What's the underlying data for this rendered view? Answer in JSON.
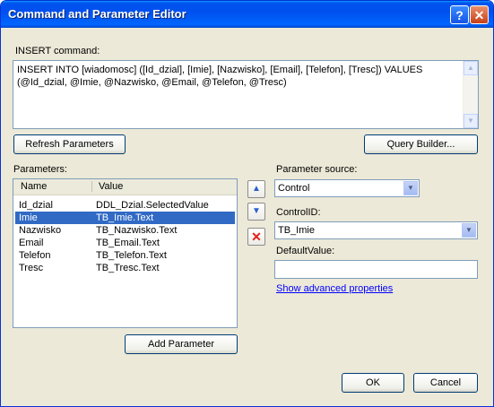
{
  "window": {
    "title": "Command and Parameter Editor",
    "help_glyph": "?",
    "close_glyph": "✕"
  },
  "command": {
    "label": "INSERT command:",
    "text": "INSERT INTO [wiadomosc] ([Id_dzial], [Imie], [Nazwisko], [Email], [Telefon], [Tresc]) VALUES\n(@Id_dzial, @Imie, @Nazwisko, @Email, @Telefon, @Tresc)"
  },
  "buttons": {
    "refresh": "Refresh Parameters",
    "query_builder": "Query Builder...",
    "add_parameter": "Add Parameter",
    "ok": "OK",
    "cancel": "Cancel"
  },
  "parameters": {
    "label": "Parameters:",
    "columns": [
      "Name",
      "Value"
    ],
    "selected_index": 1,
    "rows": [
      {
        "name": "Id_dzial",
        "value": "DDL_Dzial.SelectedValue"
      },
      {
        "name": "Imie",
        "value": "TB_Imie.Text"
      },
      {
        "name": "Nazwisko",
        "value": "TB_Nazwisko.Text"
      },
      {
        "name": "Email",
        "value": "TB_Email.Text"
      },
      {
        "name": "Telefon",
        "value": "TB_Telefon.Text"
      },
      {
        "name": "Tresc",
        "value": "TB_Tresc.Text"
      }
    ]
  },
  "side_icons": {
    "up": "arrow-up-icon",
    "down": "arrow-down-icon",
    "delete": "delete-x-icon"
  },
  "details": {
    "source_label": "Parameter source:",
    "source_value": "Control",
    "control_id_label": "ControlID:",
    "control_id_value": "TB_Imie",
    "default_label": "DefaultValue:",
    "default_value": "",
    "advanced_link": "Show advanced properties"
  },
  "colors": {
    "selection": "#316ac5",
    "titlebar": "#0053ee",
    "link": "#0000ff"
  }
}
